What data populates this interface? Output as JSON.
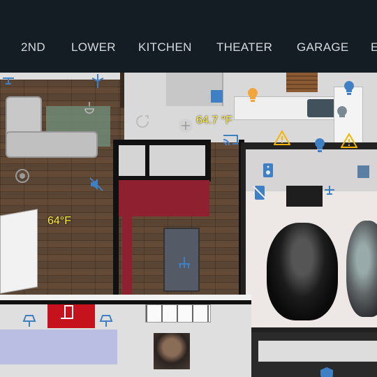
{
  "tabs": [
    {
      "label": "2ND"
    },
    {
      "label": "LOWER"
    },
    {
      "label": "KITCHEN"
    },
    {
      "label": "THEATER"
    },
    {
      "label": "GARAGE"
    },
    {
      "label": "E"
    }
  ],
  "sensors": {
    "living_room_temp": "64°F",
    "kitchen_temp": "64.7 °F"
  },
  "colors": {
    "topbar": "#141d24",
    "tab_text": "#d5dadd",
    "icon_blue": "#3f7fc4",
    "light_on": "#f3a43a",
    "alert": "#f5b400",
    "temp_text": "#ffef3b",
    "door_open": "#c6121d"
  },
  "icons": [
    "ceiling-fan-icon",
    "light-bulb-on-icon",
    "light-bulb-icon",
    "door-sensor-icon",
    "alert-triangle-icon",
    "cast-icon",
    "speaker-icon",
    "speaker-off-icon",
    "chandelier-icon",
    "motion-sensor-icon",
    "door-open-icon",
    "wall-lamp-icon",
    "camera-thumbnail"
  ]
}
